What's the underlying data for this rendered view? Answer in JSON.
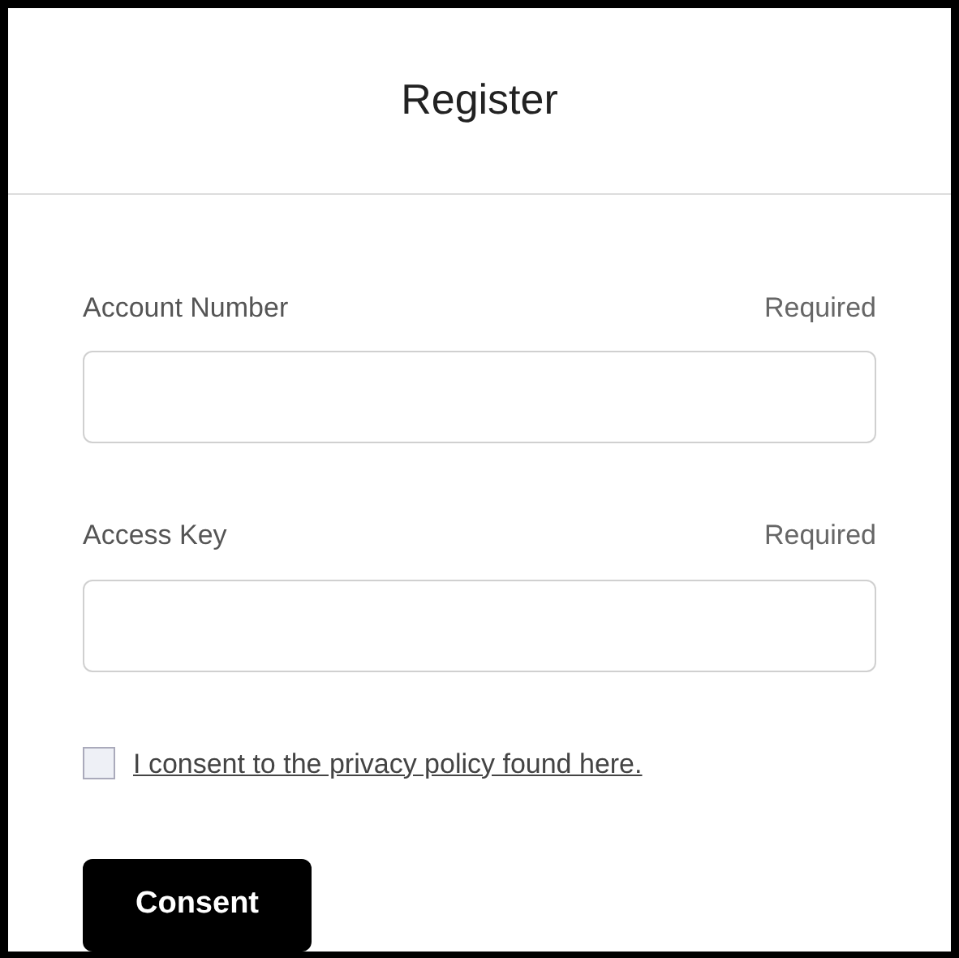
{
  "title": "Register",
  "fields": [
    {
      "label": "Account Number",
      "note": "Required"
    },
    {
      "label": "Access Key",
      "note": "Required"
    }
  ],
  "consent": {
    "checked": false,
    "text": "I consent to the privacy policy found here."
  },
  "button": "Consent"
}
